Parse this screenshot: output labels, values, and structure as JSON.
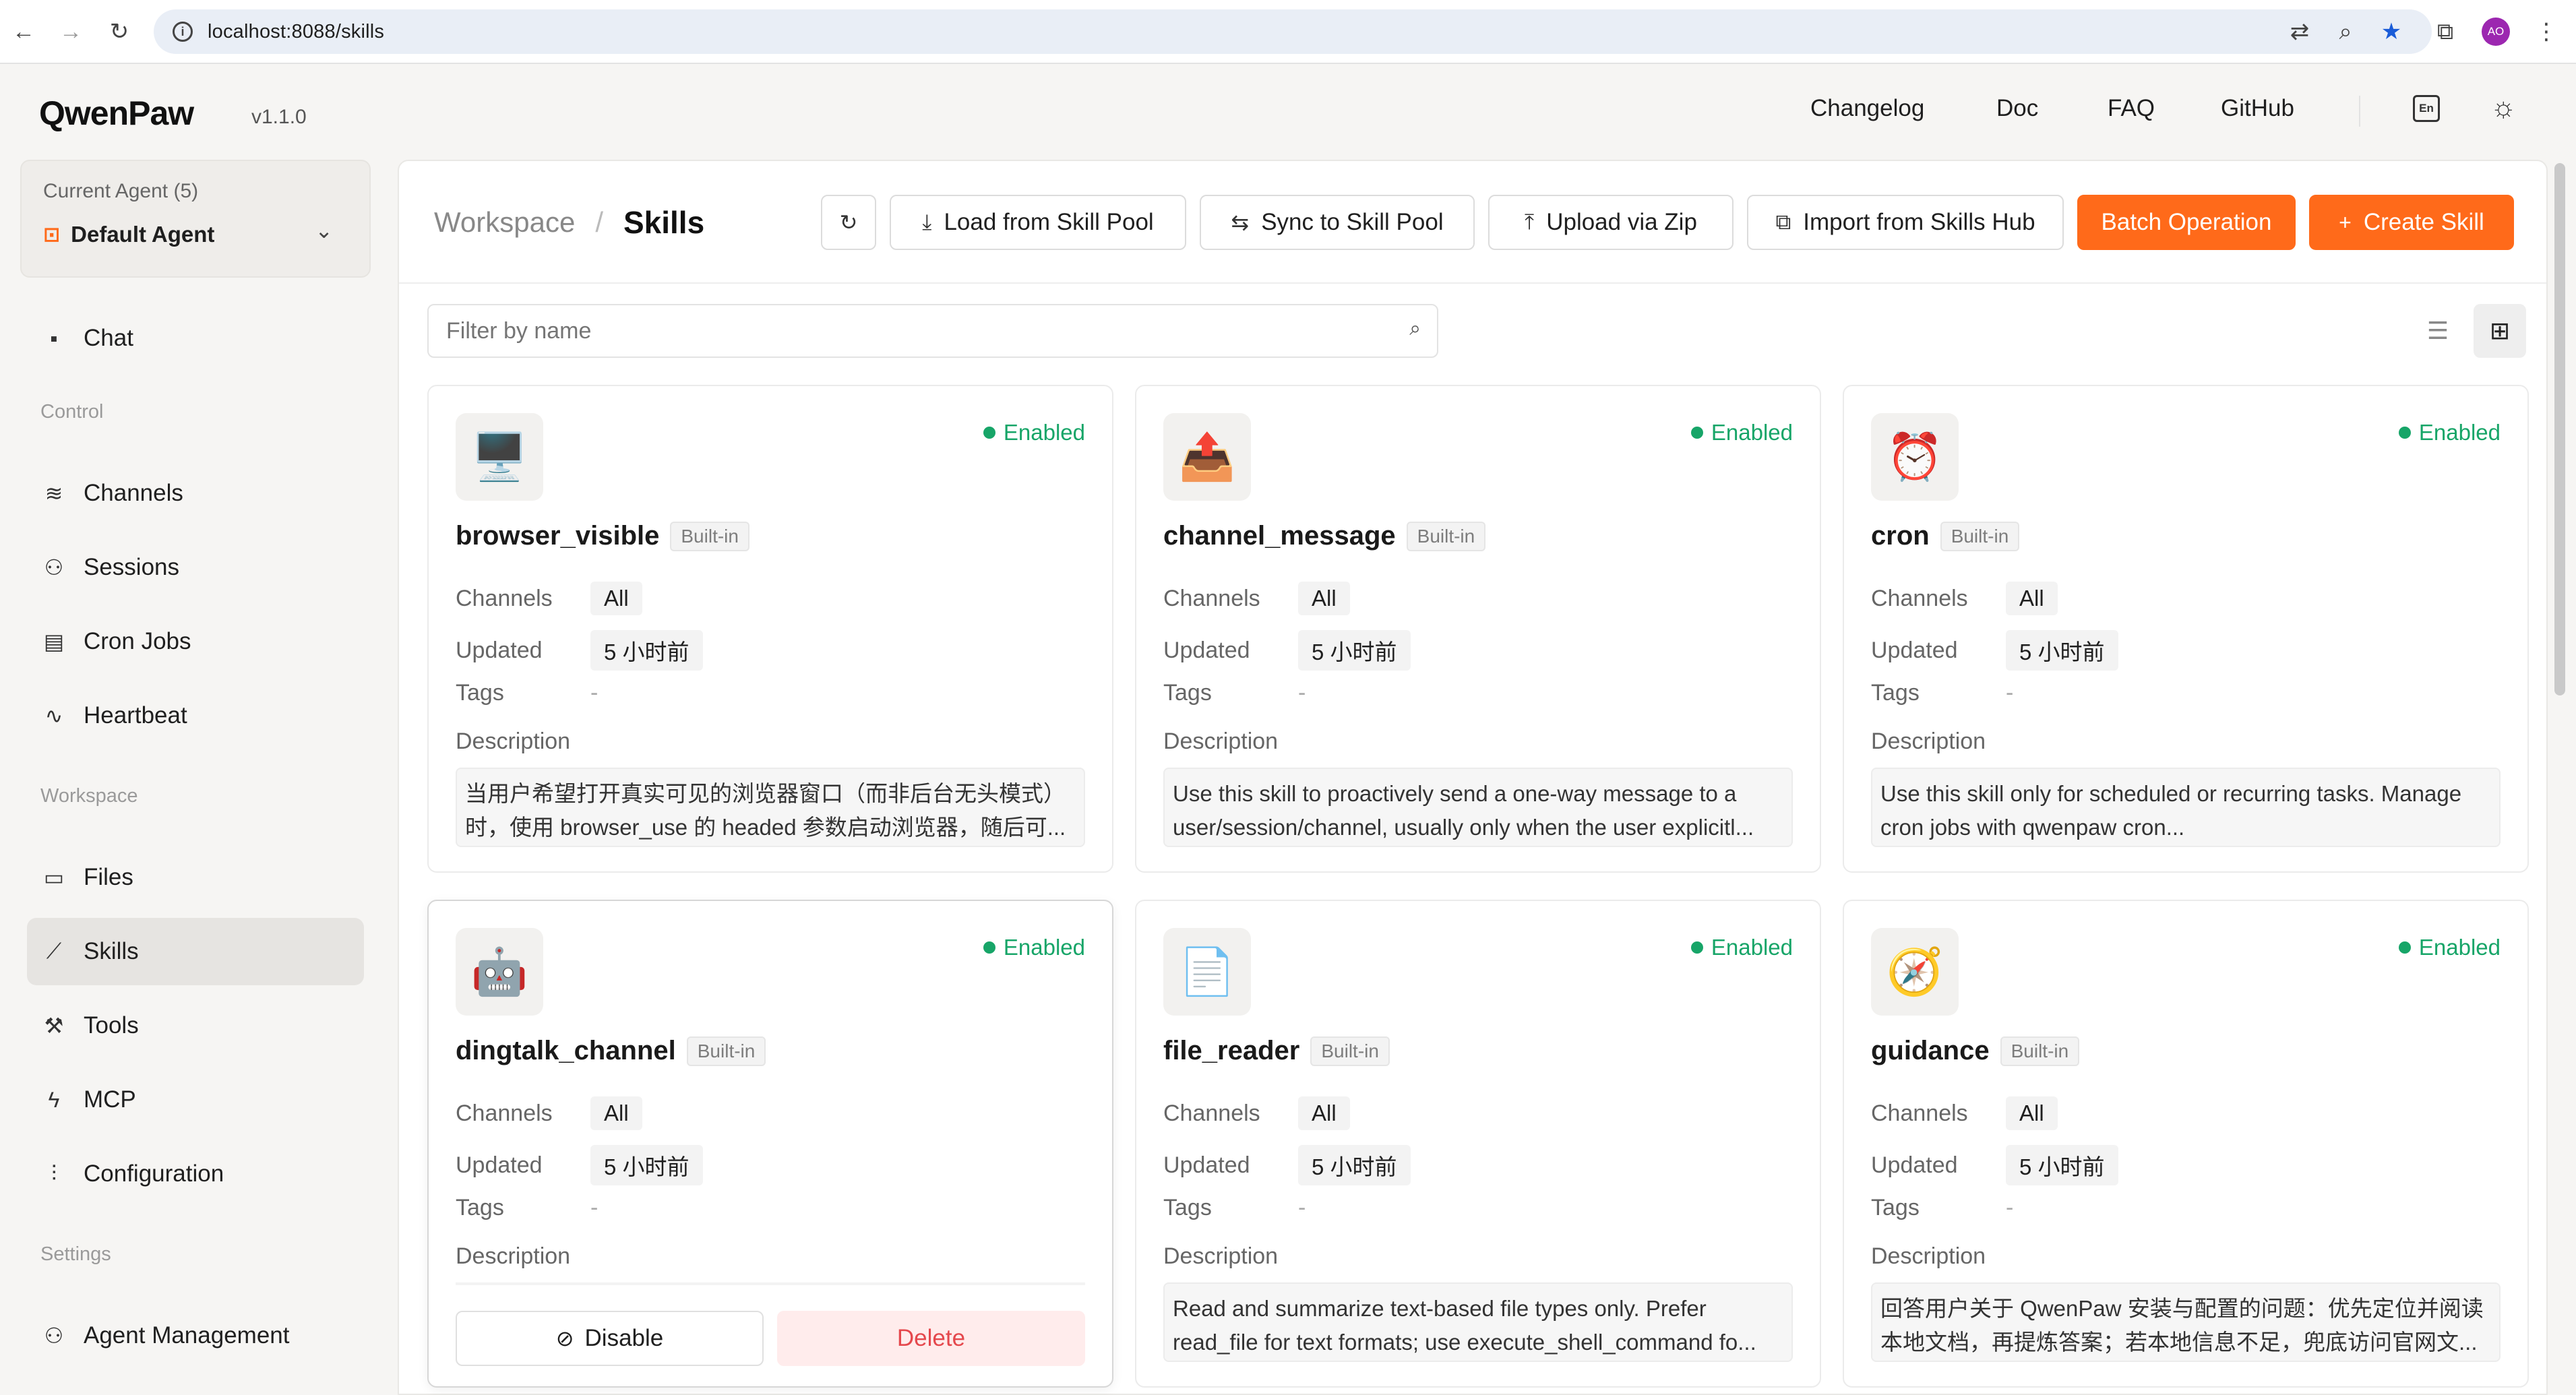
{
  "browser": {
    "url": "localhost:8088/skills",
    "avatar_initials": "AO"
  },
  "header": {
    "logo": "QwenPaw",
    "version": "v1.1.0",
    "nav": [
      "Changelog",
      "Doc",
      "FAQ",
      "GitHub"
    ],
    "lang": "En"
  },
  "sidebar": {
    "agent_label": "Current Agent (5)",
    "agent_name": "Default Agent",
    "chat": "Chat",
    "group_control": "Control",
    "channels": "Channels",
    "sessions": "Sessions",
    "cron_jobs": "Cron Jobs",
    "heartbeat": "Heartbeat",
    "group_workspace": "Workspace",
    "files": "Files",
    "skills": "Skills",
    "tools": "Tools",
    "mcp": "MCP",
    "configuration": "Configuration",
    "group_settings": "Settings",
    "agent_management": "Agent Management"
  },
  "panel": {
    "crumb_parent": "Workspace",
    "crumb_separator": "/",
    "crumb_current": "Skills",
    "load_btn": "Load from Skill Pool",
    "sync_btn": "Sync to Skill Pool",
    "upload_btn": "Upload via Zip",
    "import_btn": "Import from Skills Hub",
    "batch_btn": "Batch Operation",
    "create_btn": "Create Skill",
    "filter_placeholder": "Filter by name"
  },
  "labels": {
    "enabled": "Enabled",
    "builtin": "Built-in",
    "channels": "Channels",
    "updated": "Updated",
    "tags": "Tags",
    "description": "Description",
    "disable": "Disable",
    "delete": "Delete"
  },
  "skills": [
    {
      "name": "browser_visible",
      "icon": "🖥️",
      "channels": "All",
      "updated": "5 小时前",
      "tags": "-",
      "desc1": "当用户希望打开真实可见的浏览器窗口（而非后台无头模式）",
      "desc2": "时，使用 browser_use 的 headed 参数启动浏览器，随后可..."
    },
    {
      "name": "channel_message",
      "icon": "📤",
      "channels": "All",
      "updated": "5 小时前",
      "tags": "-",
      "desc1": "Use this skill to proactively send a one-way message to a",
      "desc2": "user/session/channel, usually only when the user explicitl..."
    },
    {
      "name": "cron",
      "icon": "⏰",
      "channels": "All",
      "updated": "5 小时前",
      "tags": "-",
      "desc1": "Use this skill only for scheduled or recurring tasks. Manage",
      "desc2": "cron jobs with qwenpaw cron..."
    },
    {
      "name": "dingtalk_channel",
      "icon": "🤖",
      "channels": "All",
      "updated": "5 小时前",
      "tags": "-",
      "desc1": "",
      "desc2": ""
    },
    {
      "name": "file_reader",
      "icon": "📄",
      "channels": "All",
      "updated": "5 小时前",
      "tags": "-",
      "desc1": "Read and summarize text-based file types only. Prefer",
      "desc2": "read_file for text formats; use execute_shell_command fo..."
    },
    {
      "name": "guidance",
      "icon": "🧭",
      "channels": "All",
      "updated": "5 小时前",
      "tags": "-",
      "desc1": "回答用户关于 QwenPaw 安装与配置的问题：优先定位并阅读",
      "desc2": "本地文档，再提炼答案；若本地信息不足，兜底访问官网文..."
    }
  ]
}
